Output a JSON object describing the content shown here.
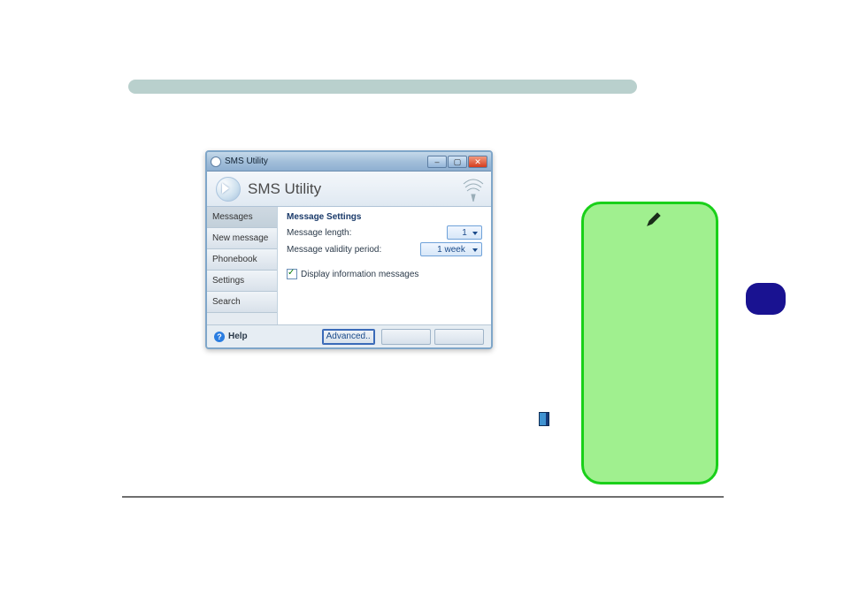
{
  "window": {
    "title": "SMS Utility",
    "app_title": "SMS Utility",
    "sidebar": {
      "items": [
        {
          "label": "Messages"
        },
        {
          "label": "New message"
        },
        {
          "label": "Phonebook"
        },
        {
          "label": "Settings"
        },
        {
          "label": "Search"
        }
      ]
    },
    "main": {
      "section_title": "Message Settings",
      "rows": {
        "length_label": "Message length:",
        "length_value": "1",
        "validity_label": "Message validity period:",
        "validity_value": "1 week"
      },
      "checkbox_label": "Display information messages"
    },
    "footer": {
      "help_label": "Help",
      "advanced_label": "Advanced..",
      "ok_label": "",
      "cancel_label": ""
    }
  },
  "icons": {
    "envelope": "envelope-icon",
    "signal": "signal-icon",
    "help": "?",
    "pen": "pen-icon"
  }
}
